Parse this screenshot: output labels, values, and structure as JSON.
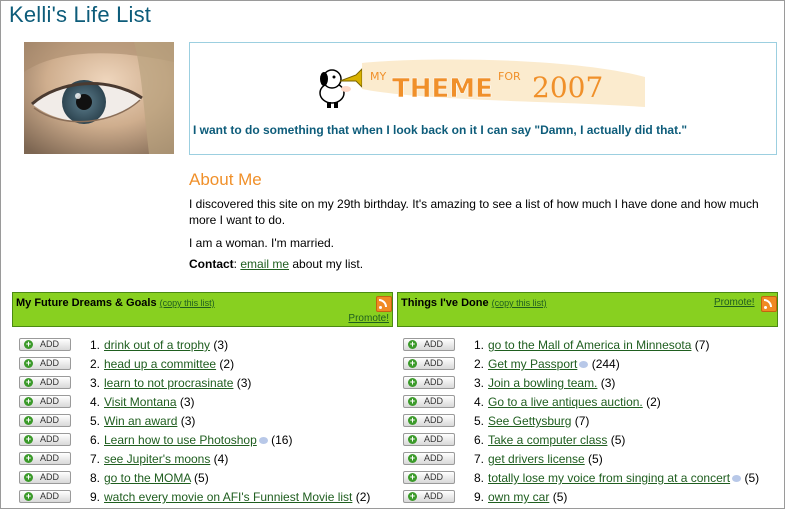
{
  "site_title": "Kelli's Life List",
  "theme": {
    "banner_words": [
      "MY",
      "THEME",
      "FOR",
      "2007"
    ],
    "statement": "I want to do something that when I look back on it I can say \"Damn, I actually did that.\""
  },
  "about": {
    "heading": "About Me",
    "paragraph1": "I discovered this site on my 29th birthday. It's amazing to see a list of how much I have done and how much more I want to do.",
    "paragraph2": "I am a woman. I'm married.",
    "contact_label": "Contact",
    "contact_sep": ": ",
    "contact_link": "email me",
    "contact_suffix": " about my list."
  },
  "lists": {
    "dreams": {
      "title": "My Future Dreams & Goals",
      "copy_link": "(copy this list)",
      "promote": "Promote!",
      "items": [
        {
          "num": "1.",
          "text": "drink out of a trophy",
          "count": " (3)",
          "comment": false
        },
        {
          "num": "2.",
          "text": "head up a committee",
          "count": " (2)",
          "comment": false
        },
        {
          "num": "3.",
          "text": "learn to not procrasinate",
          "count": " (3)",
          "comment": false
        },
        {
          "num": "4.",
          "text": "Visit Montana",
          "count": " (3)",
          "comment": false
        },
        {
          "num": "5.",
          "text": "Win an award",
          "count": " (3)",
          "comment": false
        },
        {
          "num": "6.",
          "text": "Learn how to use Photoshop",
          "count": " (16)",
          "comment": true
        },
        {
          "num": "7.",
          "text": "see Jupiter's moons",
          "count": " (4)",
          "comment": false
        },
        {
          "num": "8.",
          "text": "go to the MOMA",
          "count": " (5)",
          "comment": false
        },
        {
          "num": "9.",
          "text": "watch every movie on AFI's Funniest Movie list",
          "count": " (2)",
          "comment": false
        }
      ]
    },
    "done": {
      "title": "Things I've Done",
      "copy_link": "(copy this list)",
      "promote": "Promote!",
      "items": [
        {
          "num": "1.",
          "text": "go to the Mall of America in Minnesota",
          "count": " (7)",
          "comment": false
        },
        {
          "num": "2.",
          "text": "Get my Passport",
          "count": " (244)",
          "comment": true
        },
        {
          "num": "3.",
          "text": "Join a bowling team.",
          "count": " (3)",
          "comment": false
        },
        {
          "num": "4.",
          "text": "Go to a live antiques auction.",
          "count": " (2)",
          "comment": false
        },
        {
          "num": "5.",
          "text": "See Gettysburg",
          "count": " (7)",
          "comment": false
        },
        {
          "num": "6.",
          "text": "Take a computer class",
          "count": " (5)",
          "comment": false
        },
        {
          "num": "7.",
          "text": "get drivers license",
          "count": " (5)",
          "comment": false
        },
        {
          "num": "8.",
          "text": "totally lose my voice from singing at a concert",
          "count": " (5)",
          "comment": true
        },
        {
          "num": "9.",
          "text": "own my car",
          "count": " (5)",
          "comment": false
        }
      ]
    }
  },
  "add_label": "ADD",
  "colors": {
    "title_blue": "#0d5c7a",
    "about_orange": "#f0902a",
    "list_header_green": "#88d020",
    "link_green": "#1f5e1f"
  },
  "icons": [
    "eye-photo",
    "rss-icon",
    "add-plus-icon",
    "comment-icon",
    "trumpet-dog-icon"
  ]
}
